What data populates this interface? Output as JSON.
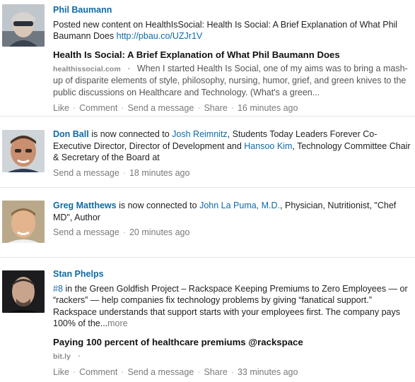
{
  "feed": [
    {
      "actor": "Phil Baumann",
      "post_text": "Posted new content on HealthIsSocial: Health Is Social: A Brief Explanation of What Phil Baumann Does",
      "post_link": "http://pbau.co/UZJr1V",
      "article_title": "Health Is Social: A Brief Explanation of What Phil Baumann Does",
      "source": "healthissocial.com",
      "snippet": "When I started Health Is Social, one of my aims was to bring a mash-up of disparite elements of style, philosophy, nursing, humor, grief, and green knives to the public discussions on Healthcare and Technology. (What's a green...",
      "actions": [
        "Like",
        "Comment",
        "Send a message",
        "Share"
      ],
      "time": "16 minutes ago"
    },
    {
      "actor": "Don Ball",
      "verb": "is now connected to",
      "conn1": "Josh Reimnitz",
      "conn1_desc": ", Students Today Leaders Forever Co-Executive Director, Director of Development and",
      "conn2": "Hansoo Kim",
      "conn2_desc": ", Technology Committee Chair & Secretary of the Board at",
      "actions": [
        "Send a message"
      ],
      "time": "18 minutes ago"
    },
    {
      "actor": "Greg Matthews",
      "verb": "is now connected to",
      "conn1": "John La Puma, M.D.",
      "conn1_desc": ", Physician, Nutritionist, \"Chef MD\", Author",
      "actions": [
        "Send a message"
      ],
      "time": "20 minutes ago"
    },
    {
      "actor": "Stan Phelps",
      "hashtag": "#8",
      "post_text": "in the Green Goldfish Project – Rackspace Keeping Premiums to Zero Employees — or “rackers” — help companies fix technology problems by giving “fanatical support.” Rackspace understands that support starts with your employees first. The company pays 100% of the...",
      "more": "more",
      "article_title": "Paying 100 percent of healthcare premiums @rackspace",
      "source": "bit.ly",
      "actions": [
        "Like",
        "Comment",
        "Send a message",
        "Share"
      ],
      "time": "33 minutes ago"
    }
  ],
  "colors": {
    "link": "#0e6aa8",
    "muted": "#7a7a7a",
    "divider": "#e4e4e4"
  },
  "icons": [
    "avatar"
  ]
}
